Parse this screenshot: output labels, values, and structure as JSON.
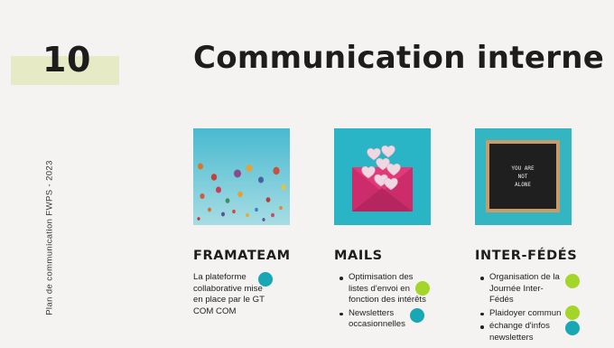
{
  "slide": {
    "number": "10",
    "title": "Communication interne",
    "side_caption": "Plan de communication FWPS - 2023"
  },
  "columns": [
    {
      "heading": "FRAMATEAM",
      "image_icon": "hot-air-balloons-photo",
      "text": "La plateforme collaborative mise en place par le GT COM COM",
      "badge": {
        "color": "#19a7b5"
      }
    },
    {
      "heading": "MAILS",
      "image_icon": "envelope-hearts-photo",
      "bullets": [
        {
          "text": "Optimisation des listes d'envoi en fonction des intérêts",
          "badge_color": "#a4d62a"
        },
        {
          "text": "Newsletters occasionnelles",
          "badge_color": "#19a7b5"
        }
      ]
    },
    {
      "heading": "INTER-FÉDÉS",
      "image_icon": "letter-board-photo",
      "photo_text": [
        "YOU ARE",
        "NOT",
        "ALONE"
      ],
      "bullets": [
        {
          "text": "Organisation de la Journée Inter-Fédés",
          "badge_color": "#a4d62a"
        },
        {
          "text": "Plaidoyer commun",
          "badge_color": "#a4d62a"
        },
        {
          "text": "échange d'infos newsletters",
          "badge_color": "#19a7b5"
        }
      ]
    }
  ],
  "colors": {
    "background": "#f4f3f1",
    "number_band": "#e6ebc6",
    "teal_badge": "#19a7b5",
    "lime_badge": "#a4d62a"
  }
}
